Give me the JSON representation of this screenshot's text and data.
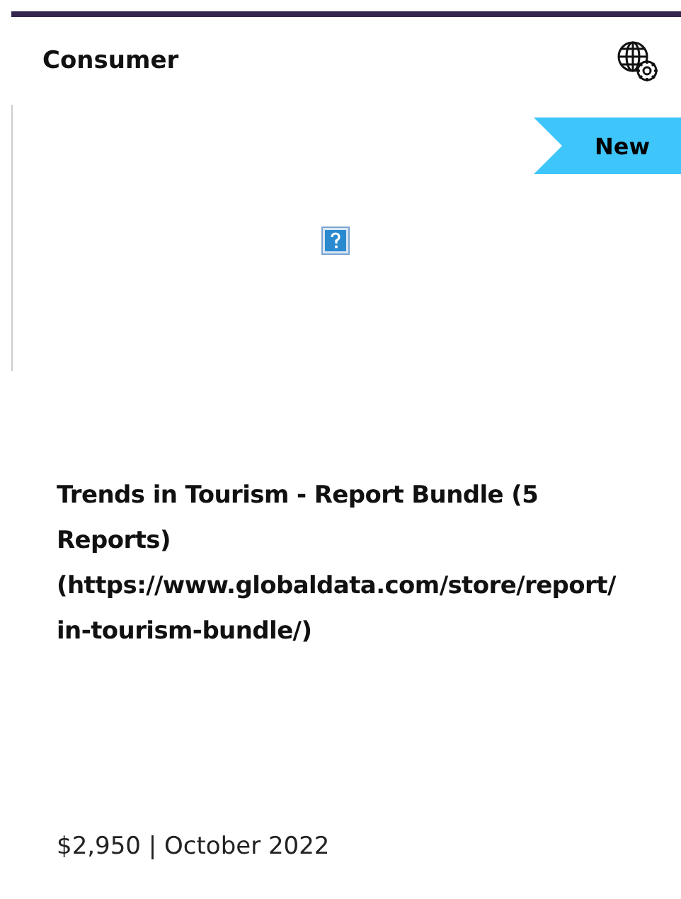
{
  "category": "Consumer",
  "badge": "New",
  "image": {
    "kind": "broken"
  },
  "title_lines": [
    "Trends in Tourism - Report Bundle (5",
    "Reports)",
    "(https://www.globaldata.com/store/report/",
    "in-tourism-bundle/)"
  ],
  "meta": "$2,950 | October 2022"
}
